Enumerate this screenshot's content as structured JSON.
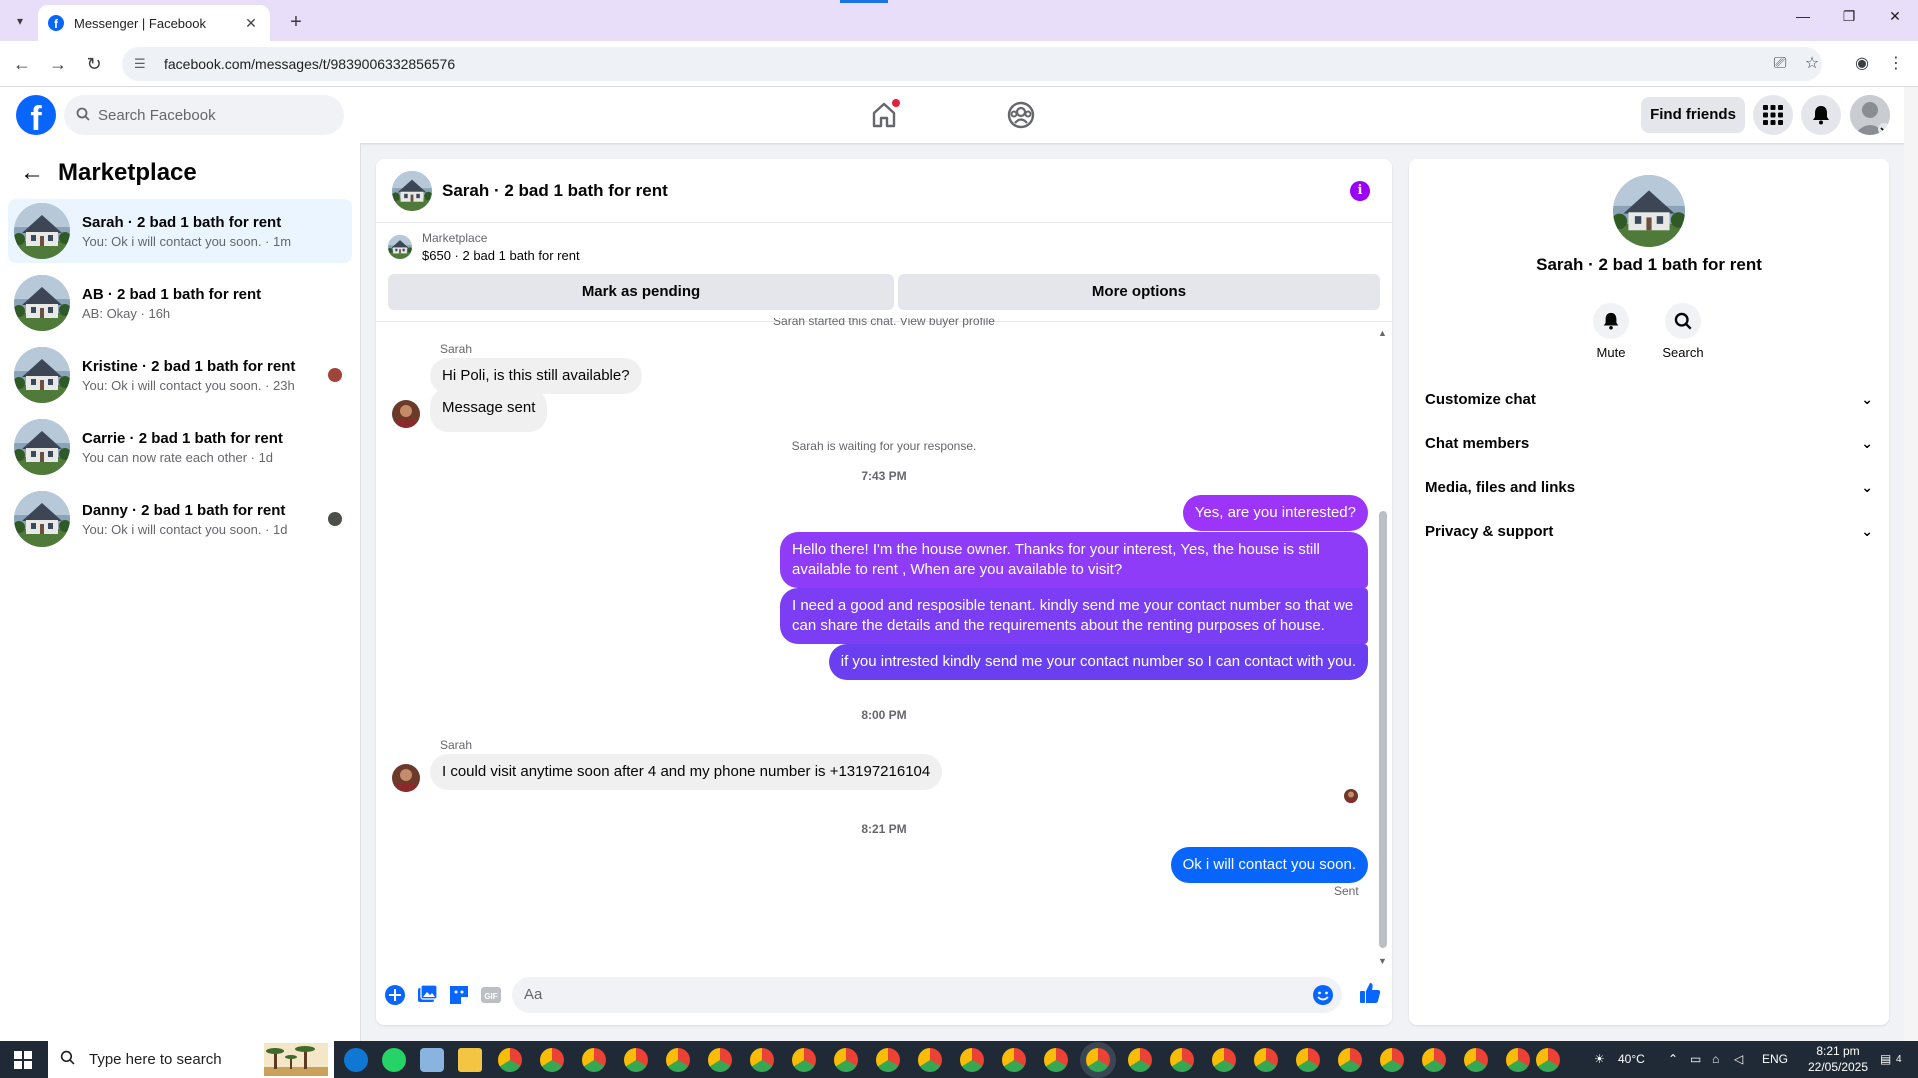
{
  "browser": {
    "tab_title": "Messenger | Facebook",
    "url": "facebook.com/messages/t/9839006332856576"
  },
  "fb": {
    "search_placeholder": "Search Facebook",
    "find_friends": "Find friends"
  },
  "sidebar": {
    "title": "Marketplace",
    "conversations": [
      {
        "name": "Sarah · 2 bad 1 bath for rent",
        "snippet": "You: Ok i will contact you soon. · 1m"
      },
      {
        "name": "AB · 2 bad 1 bath for rent",
        "snippet": "AB: Okay · 16h"
      },
      {
        "name": "Kristine · 2 bad 1 bath for rent",
        "snippet": "You: Ok i will contact you soon. · 23h"
      },
      {
        "name": "Carrie · 2 bad 1 bath for rent",
        "snippet": "You can now rate each other · 1d"
      },
      {
        "name": "Danny · 2 bad 1 bath for rent",
        "snippet": "You: Ok i will contact you soon. · 1d"
      }
    ]
  },
  "chat": {
    "title": "Sarah · 2 bad 1 bath for rent",
    "listing_source": "Marketplace",
    "listing_detail": "$650 · 2 bad 1 bath for rent",
    "mark_pending": "Mark as pending",
    "more_options": "More options",
    "started_text": "Sarah started this chat. View buyer profile",
    "sender": "Sarah",
    "msg1": "Hi Poli, is this still available?",
    "msg2": "Message sent",
    "waiting": "Sarah is waiting for your response.",
    "time1": "7:43 PM",
    "out1": "Yes, are you interested?",
    "out2": "Hello there! I'm the house owner. Thanks for your interest, Yes, the house is still available to rent , When are you available to visit?",
    "out3": "I need a good and resposible tenant.  kindly send me your contact number so that we can share the details and the requirements about the renting purposes of house.",
    "out4": "if you intrested kindly send me your contact number so I can contact with you.",
    "time2": "8:00 PM",
    "sender2": "Sarah",
    "msg3": "I could visit anytime soon after 4 and my phone number is +13197216104",
    "time3": "8:21 PM",
    "out5": "Ok i will contact you soon.",
    "sent_status": "Sent",
    "composer_placeholder": "Aa",
    "gif_label": "GIF"
  },
  "details": {
    "name": "Sarah · 2 bad 1 bath for rent",
    "mute": "Mute",
    "search": "Search",
    "rows": [
      "Customize chat",
      "Chat members",
      "Media, files and links",
      "Privacy & support"
    ]
  },
  "taskbar": {
    "search_placeholder": "Type here to search",
    "temperature": "40°C",
    "language": "ENG",
    "time": "8:21 pm",
    "date": "22/05/2025",
    "notifications": "4"
  },
  "colors": {
    "fb_blue": "#0866ff",
    "bubble_out_start": "#a033ff",
    "bubble_out_end": "#0866ff"
  }
}
